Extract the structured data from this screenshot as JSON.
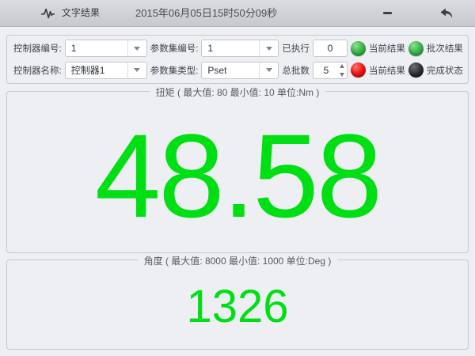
{
  "titlebar": {
    "title": "文字结果",
    "timestamp": "2015年06月05日15时50分09秒"
  },
  "form": {
    "rows": [
      {
        "fields": [
          {
            "label": "控制器编号:",
            "value": "1"
          },
          {
            "label": "参数集编号:",
            "value": "1"
          }
        ],
        "counter": {
          "label": "已执行",
          "value": "0"
        },
        "indicators": [
          {
            "label": "当前结果",
            "color": "green"
          },
          {
            "label": "批次结果",
            "color": "green"
          }
        ]
      },
      {
        "fields": [
          {
            "label": "控制器名称:",
            "value": "控制器1"
          },
          {
            "label": "参数集类型:",
            "value": "Pset"
          }
        ],
        "counter": {
          "label": "总批数",
          "value": "5"
        },
        "indicators": [
          {
            "label": "当前结果",
            "color": "red"
          },
          {
            "label": "完成状态",
            "color": "black"
          }
        ]
      }
    ]
  },
  "torque_panel": {
    "legend": "扭矩 ( 最大值: 80  最小值: 10  单位:Nm )",
    "value": "48.58"
  },
  "angle_panel": {
    "legend": "角度 ( 最大值: 8000  最小值: 1000  单位:Deg )",
    "value": "1326"
  },
  "colors": {
    "value_green": "#00df14",
    "indicator_green": "#3bb44a",
    "indicator_red": "#ee1414",
    "indicator_black": "#1b1b1d",
    "titlebar_gradient_top": "#dadce0",
    "titlebar_gradient_bottom": "#c7c9cf",
    "panel_border": "#c6c8ce",
    "page_background": "#edeff2"
  }
}
